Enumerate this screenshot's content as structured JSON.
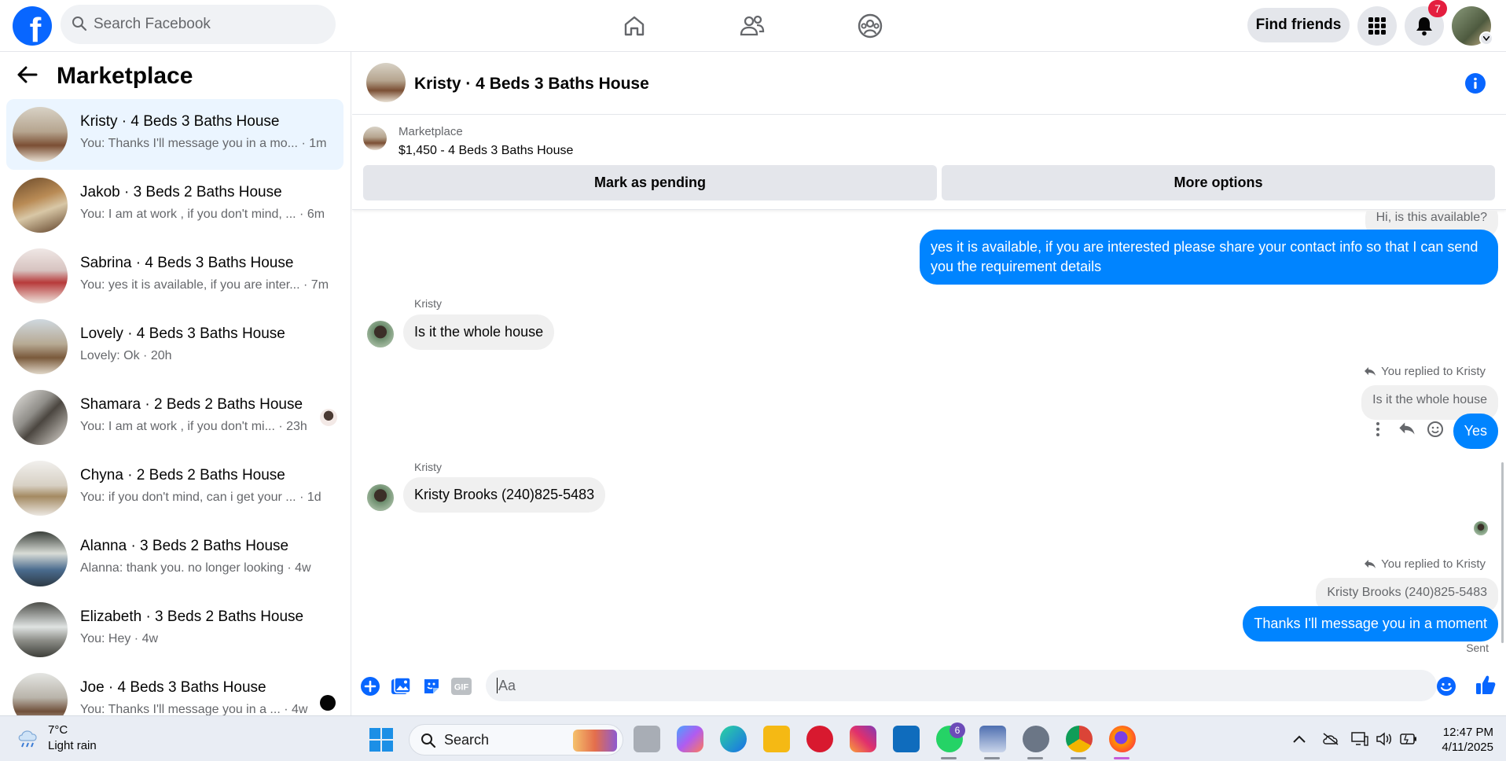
{
  "topbar": {
    "logo": "f",
    "search_placeholder": "Search Facebook",
    "find_friends": "Find friends",
    "notification_count": "7",
    "accent": "#0866ff"
  },
  "sidebar": {
    "title": "Marketplace",
    "conversations": [
      {
        "name": "Kristy · 4 Beds 3 Baths House",
        "preview": "You: Thanks I'll message you in a mo...",
        "time": "· 1m",
        "active": true
      },
      {
        "name": "Jakob · 3 Beds 2 Baths House",
        "preview": "You: I am at work , if you don't mind, ...",
        "time": "· 6m"
      },
      {
        "name": "Sabrina · 4 Beds 3 Baths House",
        "preview": "You: yes it is available, if you are inter...",
        "time": "· 7m"
      },
      {
        "name": "Lovely · 4 Beds 3 Baths House",
        "preview": "Lovely: Ok",
        "time": "· 20h"
      },
      {
        "name": "Shamara · 2 Beds 2 Baths House",
        "preview": "You: I am at work , if you don't mi...",
        "time": "· 23h"
      },
      {
        "name": "Chyna · 2 Beds 2 Baths House",
        "preview": "You: if you don't mind, can i get your ...",
        "time": "· 1d"
      },
      {
        "name": "Alanna · 3 Beds 2 Baths House",
        "preview": "Alanna: thank you. no longer looking",
        "time": "· 4w"
      },
      {
        "name": "Elizabeth · 3 Beds 2 Baths House",
        "preview": "You: Hey",
        "time": "· 4w"
      },
      {
        "name": "Joe · 4 Beds 3 Baths House",
        "preview": "You: Thanks I'll message you in a ...",
        "time": "· 4w"
      }
    ]
  },
  "chat": {
    "title": "Kristy · 4 Beds 3 Baths House",
    "listing": {
      "label": "Marketplace",
      "price_title": "$1,450 - 4 Beds 3 Baths House",
      "mark_pending": "Mark as pending",
      "more_options": "More options"
    },
    "messages": {
      "quote_top": "Hi, is this available?",
      "out1": "yes it is available, if you are interested please share your contact info so that I can send you the requirement details",
      "sender1": "Kristy",
      "in1": "Is it the whole house",
      "reply_note1": "You replied to Kristy",
      "quote1": "Is it the whole house",
      "out2": "Yes",
      "sender2": "Kristy",
      "in2": "Kristy Brooks (240)825-5483",
      "reply_note2": "You replied to Kristy",
      "quote2": "Kristy Brooks (240)825-5483",
      "out3": "Thanks I'll message you in a moment",
      "status": "Sent"
    },
    "composer_placeholder": "Aa"
  },
  "taskbar": {
    "temperature": "7°C",
    "weather": "Light rain",
    "search": "Search",
    "whatsapp_badge": "6",
    "time": "12:47 PM",
    "date": "4/11/2025"
  }
}
